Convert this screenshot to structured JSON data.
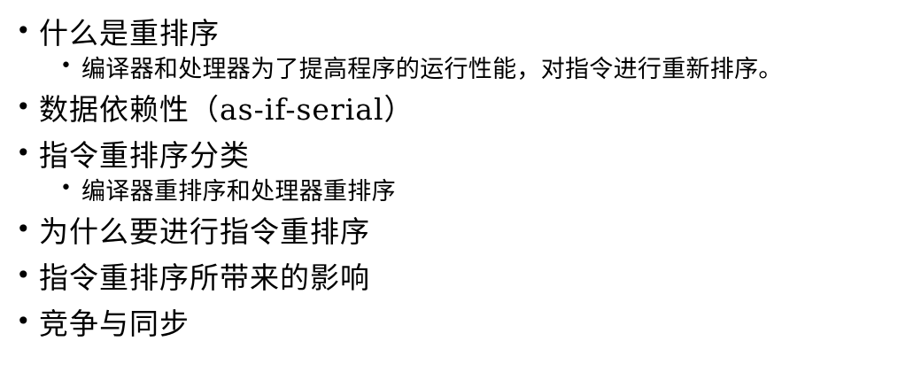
{
  "bullet_glyph": "•",
  "items": [
    {
      "text": "什么是重排序",
      "children": [
        "编译器和处理器为了提高程序的运行性能，对指令进行重新排序。"
      ]
    },
    {
      "text": "数据依赖性（as-if-serial）",
      "children": []
    },
    {
      "text": "指令重排序分类",
      "children": [
        "编译器重排序和处理器重排序"
      ]
    },
    {
      "text": "为什么要进行指令重排序",
      "children": []
    },
    {
      "text": "指令重排序所带来的影响",
      "children": []
    },
    {
      "text": "竞争与同步",
      "children": []
    }
  ]
}
